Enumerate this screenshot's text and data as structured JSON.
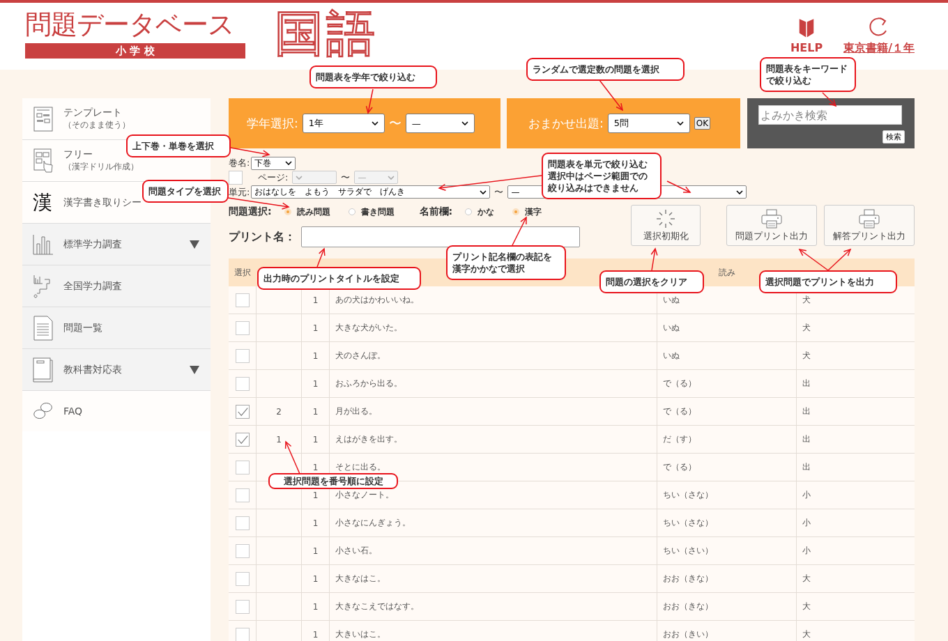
{
  "header": {
    "logo_title": "問題データベース",
    "logo_subtitle": "小 学 校",
    "subject": "国語",
    "help_label": "HELP",
    "textbook_link": "東京書籍/１年"
  },
  "sidebar": {
    "items": [
      {
        "kind": "template",
        "label": "テンプレート",
        "sublabel": "（そのまま使う）",
        "shaded": false,
        "has_submenu": false
      },
      {
        "kind": "free",
        "label": "フリー",
        "sublabel": "（漢字ドリル作成）",
        "shaded": false,
        "has_submenu": false
      },
      {
        "kind": "kanji",
        "icon_char": "漢",
        "label": "漢字書き取りシー",
        "shaded": false,
        "has_submenu": false
      },
      {
        "kind": "bars",
        "label": "標準学力調査",
        "shaded": true,
        "has_submenu": true
      },
      {
        "kind": "map",
        "label": "全国学力調査",
        "shaded": true,
        "has_submenu": false
      },
      {
        "kind": "list",
        "label": "問題一覧",
        "shaded": true,
        "has_submenu": false
      },
      {
        "kind": "book",
        "label": "教科書対応表",
        "shaded": true,
        "has_submenu": true
      },
      {
        "kind": "faq",
        "label": "FAQ",
        "shaded": false,
        "has_submenu": false
      }
    ]
  },
  "grade_filter": {
    "label": "学年選択:",
    "from": "1年",
    "separator": "〜",
    "to": "—"
  },
  "random": {
    "label": "おまかせ出題:",
    "count": "5問",
    "ok": "OK"
  },
  "search": {
    "placeholder": "よみかき検索",
    "button": "検索"
  },
  "volume": {
    "label": "巻名:",
    "value": "下巻"
  },
  "page_range": {
    "checked": false,
    "label": "ページ:",
    "separator": "〜",
    "to": "—",
    "disabled": true
  },
  "unit": {
    "label": "単元:",
    "from": "おはなしを　よもう　サラダで　げんき",
    "separator": "〜",
    "to": "—"
  },
  "question_type": {
    "label": "問題選択:",
    "options": [
      {
        "label": "読み問題",
        "selected": true
      },
      {
        "label": "書き問題",
        "selected": false
      }
    ]
  },
  "name_field": {
    "label": "名前欄:",
    "options": [
      {
        "label": "かな",
        "selected": false
      },
      {
        "label": "漢字",
        "selected": true
      }
    ]
  },
  "print_name": {
    "label": "プリント名："
  },
  "actions": [
    {
      "kind": "reset",
      "label": "選択初期化"
    },
    {
      "kind": "print",
      "label": "問題プリント出力"
    },
    {
      "kind": "print",
      "label": "解答プリント出力"
    }
  ],
  "table": {
    "select_label": "選択",
    "reading_label": "読み",
    "rows": [
      {
        "checked": false,
        "count": "1",
        "sentence": "あの犬はかわいいね。",
        "reading": "いぬ",
        "kanji": "犬"
      },
      {
        "checked": false,
        "count": "1",
        "sentence": "大きな犬がいた。",
        "reading": "いぬ",
        "kanji": "犬"
      },
      {
        "checked": false,
        "count": "1",
        "sentence": "犬のさんぽ。",
        "reading": "いぬ",
        "kanji": "犬"
      },
      {
        "checked": false,
        "count": "1",
        "sentence": "おふろから出る。",
        "reading": "で（る）",
        "kanji": "出"
      },
      {
        "checked": true,
        "order": "2",
        "count": "1",
        "sentence": "月が出る。",
        "reading": "で（る）",
        "kanji": "出"
      },
      {
        "checked": true,
        "order": "1",
        "count": "1",
        "sentence": "えはがきを出す。",
        "reading": "だ（す）",
        "kanji": "出"
      },
      {
        "checked": false,
        "count": "1",
        "sentence": "そとに出る。",
        "reading": "で（る）",
        "kanji": "出"
      },
      {
        "checked": false,
        "count": "1",
        "sentence": "小さなノート。",
        "reading": "ちい（さな）",
        "kanji": "小"
      },
      {
        "checked": false,
        "count": "1",
        "sentence": "小さなにんぎょう。",
        "reading": "ちい（さな）",
        "kanji": "小"
      },
      {
        "checked": false,
        "count": "1",
        "sentence": "小さい石。",
        "reading": "ちい（さい）",
        "kanji": "小"
      },
      {
        "checked": false,
        "count": "1",
        "sentence": "大きなはこ。",
        "reading": "おお（きな）",
        "kanji": "大"
      },
      {
        "checked": false,
        "count": "1",
        "sentence": "大きなこえではなす。",
        "reading": "おお（きな）",
        "kanji": "大"
      },
      {
        "checked": false,
        "count": "1",
        "sentence": "大きいはこ。",
        "reading": "おお（きい）",
        "kanji": "大"
      }
    ]
  },
  "callouts": [
    {
      "text": "問題表を学年で絞り込む"
    },
    {
      "text": "ランダムで選定数の問題を選択"
    },
    {
      "text": "問題表をキーワードで絞り込む"
    },
    {
      "text": "上下巻・単巻を選択"
    },
    {
      "text": "問題タイプを選択"
    },
    {
      "text": "問題表を単元で絞り込む選択中はページ範囲での絞り込みはできません"
    },
    {
      "text": "プリント記名欄の表記を漢字かかなで選択"
    },
    {
      "text": "出力時のプリントタイトルを設定"
    },
    {
      "text": "問題の選択をクリア"
    },
    {
      "text": "選択問題でプリントを出力"
    },
    {
      "text": "選択問題を番号順に設定"
    }
  ]
}
